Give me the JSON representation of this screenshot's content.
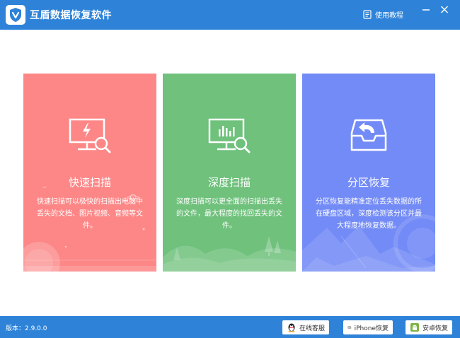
{
  "app": {
    "title": "互盾数据恢复软件",
    "help_label": "使用教程",
    "logo_icon": "shield-v-icon"
  },
  "colors": {
    "titlebar": "#2e83d9",
    "quick": "#fd8787",
    "deep": "#6fc17c",
    "partition": "#738bf6"
  },
  "cards": [
    {
      "key": "quick",
      "icon": "monitor-lightning-search-icon",
      "title": "快速扫描",
      "desc": "快速扫描可以极快的扫描出电脑中丢失的文档、图片视频、音频等文件。"
    },
    {
      "key": "deep",
      "icon": "monitor-chart-search-icon",
      "title": "深度扫描",
      "desc": "深度扫描可以更全面的扫描出丢失的文件，最大程度的找回丢失的文件。"
    },
    {
      "key": "partition",
      "icon": "tray-restore-icon",
      "title": "分区恢复",
      "desc": "分区恢复能精准定位丢失数据的所在硬盘区域，深度检测该分区并最大程度地恢复数据。"
    }
  ],
  "footer": {
    "version": "版本：2.9.0.0",
    "service_label": "在线客服",
    "iphone_label": "iPhone恢复",
    "android_label": "安卓恢复"
  }
}
